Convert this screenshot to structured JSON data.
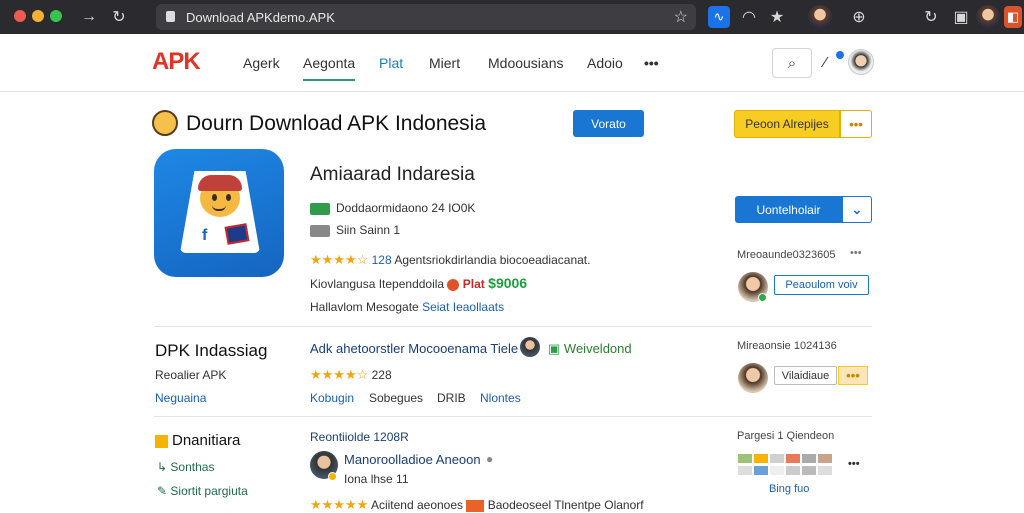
{
  "browser": {
    "url": "Download APKdemo.APK",
    "colors": {
      "frame": "#2b2b2f",
      "omnibox": "#3d3d42"
    }
  },
  "nav": {
    "logo": "APK",
    "items": [
      "Agerk",
      "Aegonta",
      "Plat",
      "Miert",
      "Mdoousians",
      "Adoio"
    ],
    "more": "•••",
    "active_index": 2
  },
  "header": {
    "title": "Dourn Download APK Indonesia",
    "primary_button": "Vorato",
    "secondary_button": "Peoon Alrepijes",
    "more": "•••"
  },
  "app": {
    "name": "Amiaarad Indaresia",
    "line1": "Doddaormidaono 24 IO0K",
    "line2": "Siin Sainn 1",
    "rating_count": "128",
    "rating_text": "Agentsriokdirlandia biocoeadiacanat.",
    "line4_text": "Kiovlangusa Itependdoila",
    "line4_tag": "Plat",
    "price": "$9006",
    "line5_text": "Hallavlom Mesogate",
    "line5_link": "Seiat Ieaollaats",
    "install_button": "Uontelholair"
  },
  "side": {
    "label1": "Mreoaunde0323605",
    "button1": "Peaoulom voiv",
    "label2": "Mireaonsie 1024136",
    "button2": "Vilaidiaue",
    "label3": "Pargesi 1 Qiendeon",
    "link3": "Bing fuo",
    "more": "•••"
  },
  "section1": {
    "title": "DPK Indassiag",
    "sub1": "Reoalier APK",
    "sub2": "Neguaina",
    "heading": "Adk ahetoorstler Mocooenama Tiele",
    "verified": "Weiveldond",
    "rating": "228",
    "links": [
      "Kobugin",
      "Sobegues",
      "DRIB",
      "Nlontes"
    ]
  },
  "section2": {
    "title": "Dnanitiara",
    "items": [
      "Sonthas",
      "Siortit pargiuta"
    ],
    "heading": "Reontiiolde 1208R",
    "reviewer": "Manoroolladioe Aneoon",
    "reviewer_sub": "Iona lhse 11",
    "review_text": "Baodeoseel Tlnentpe Olanorf",
    "review_prefix": "Aciitend aeonoes"
  }
}
